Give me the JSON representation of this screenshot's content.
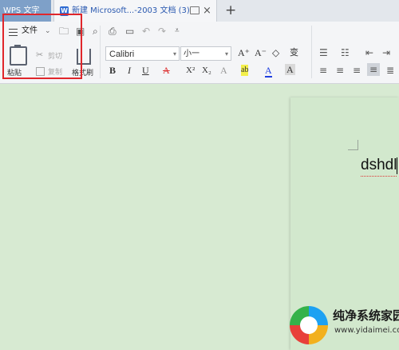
{
  "tabs": {
    "app": "WPS 文字",
    "doc": "新建 Microsoft...-2003 文档 (3)",
    "doc_icon": "W",
    "close": "×",
    "new": "+"
  },
  "toolbar": {
    "file_menu": "文件",
    "chevron": "⌄",
    "open_icon": "🗀",
    "save_icon": "▣",
    "find_icon": "⌕",
    "print_icon": "⎙",
    "preview_icon": "▭",
    "undo_icon": "↶",
    "redo_icon": "↷",
    "more_icon": "⩡"
  },
  "clipboard": {
    "paste_label": "粘贴",
    "cut_label": "剪切",
    "copy_label": "复制",
    "format_painter_label": "格式刷"
  },
  "font": {
    "name": "Calibri",
    "size": "小一",
    "grow": "A⁺",
    "shrink": "A⁻",
    "clear": "◇",
    "phonetic": "变",
    "bold": "B",
    "italic": "I",
    "underline": "U",
    "strike": "A",
    "superscript": "X²",
    "subscript": "X₂",
    "effect": "A",
    "highlight": "ab",
    "color": "A",
    "shade": "A"
  },
  "document": {
    "text": "dshdl"
  },
  "watermark": {
    "title": "纯净系统家园",
    "url": "www.yidaimei.com"
  },
  "colors": {
    "highlight_box": "#e0262b",
    "app_tab": "#7ea0c8",
    "doc_background": "#d7ead2"
  }
}
